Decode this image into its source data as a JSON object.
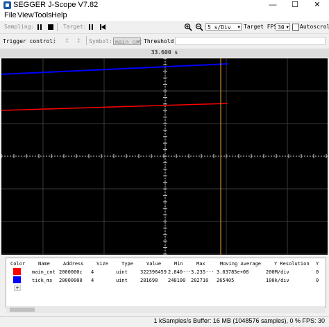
{
  "window": {
    "title": "SEGGER J-Scope V7.82",
    "min": "—",
    "max": "☐",
    "close": "✕"
  },
  "menu": [
    "File",
    "View",
    "Tools",
    "Help"
  ],
  "toolbar": {
    "sampling_label": "Sampling:",
    "target_label": "Target:",
    "zoom_value": "5 s/Div",
    "fps_label": "Target FPS:",
    "fps_value": "30",
    "autoscroll_label": "Autoscroll"
  },
  "trigger": {
    "label": "Trigger control:",
    "symbol_label": "Symbol:",
    "symbol_value": "main_cnt",
    "threshold_label": "Threshold:"
  },
  "plot": {
    "cursor_time": "33.600 s"
  },
  "colors": {
    "main_cnt": "#ff0000",
    "tick_ms": "#0000ff",
    "cursor": "#cc8a2a",
    "grid": "#3a3a3a"
  },
  "table": {
    "headers": [
      "Color",
      "Name",
      "Address",
      "Size",
      "Type",
      "Value",
      "Min",
      "Max",
      "Moving Average",
      "Y Resolution",
      "Y"
    ],
    "rows": [
      {
        "color": "#ff0000",
        "name": "main_cnt",
        "address": "2000000c",
        "size": "4",
        "type": "uint",
        "value": "322396459",
        "min": "2.840···",
        "max": "3.235···",
        "avg": "3.03785e+08",
        "yres": "200M/div",
        "y": "0"
      },
      {
        "color": "#0000ff",
        "name": "tick_ms",
        "address": "20000000",
        "size": "4",
        "type": "uint",
        "value": "281698",
        "min": "248100",
        "max": "282710",
        "avg": "265405",
        "yres": "100k/div",
        "y": "0"
      }
    ],
    "add_label": "+"
  },
  "status": {
    "text": "1 kSamples/s Buffer: 16 MB (1048576 samples), 0 % FPS: 30"
  }
}
